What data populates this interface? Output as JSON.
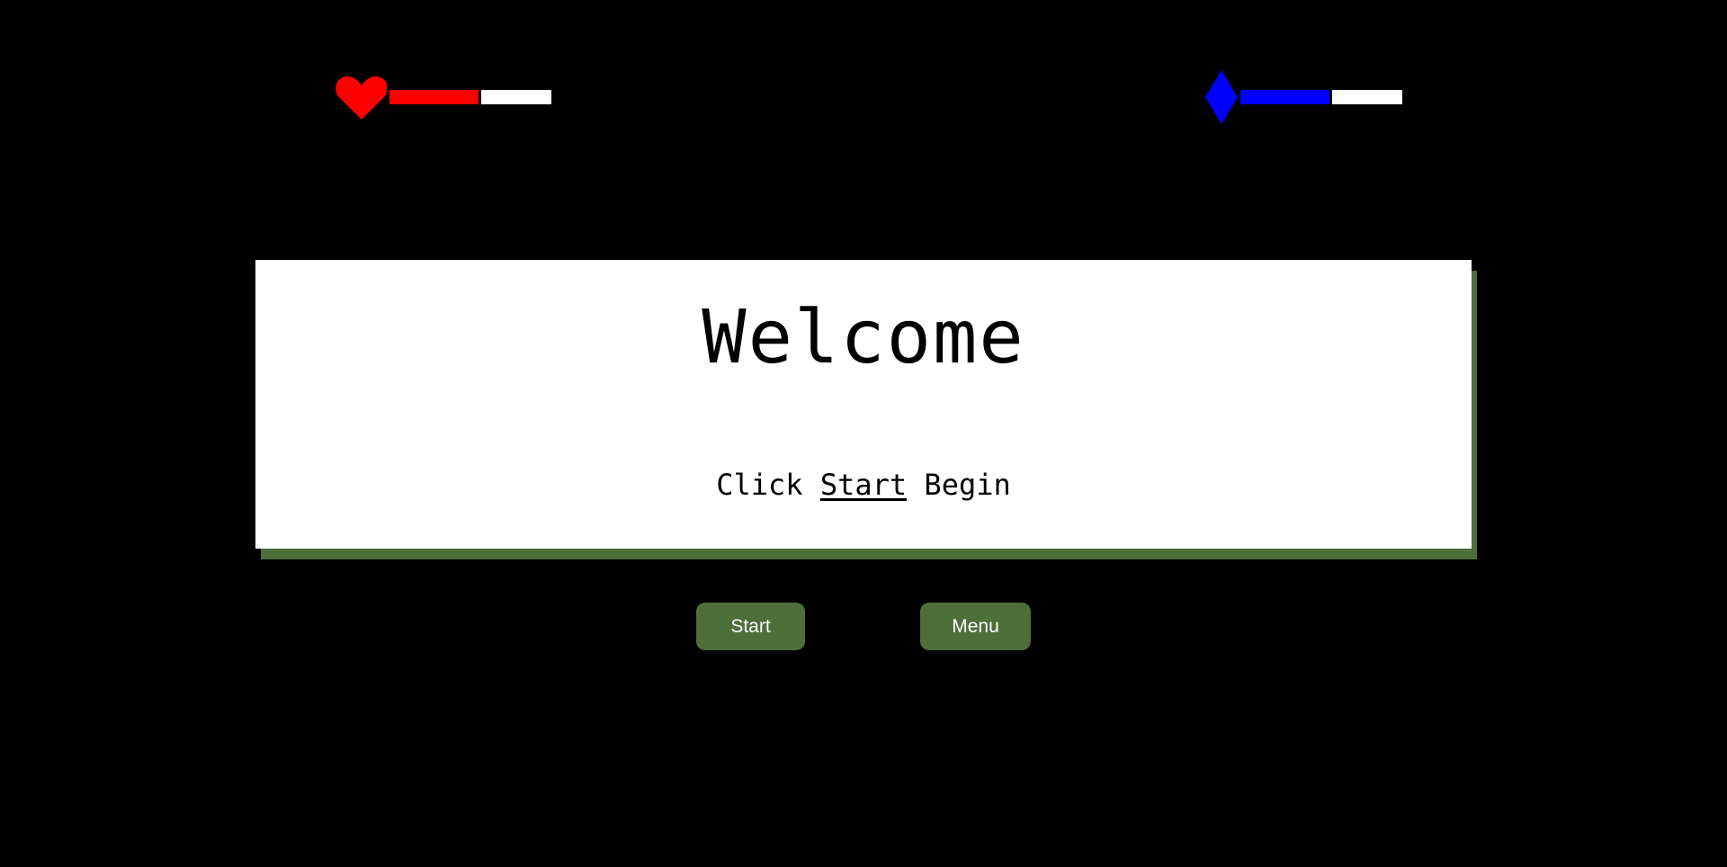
{
  "hud": {
    "health": {
      "icon": "heart-icon",
      "color": "#ff0000",
      "fill_fraction": 0.55
    },
    "mana": {
      "icon": "diamond-icon",
      "color": "#0000ff",
      "fill_fraction": 0.55
    }
  },
  "dialog": {
    "title": "Welcome",
    "hint_prefix": "Click",
    "hint_link": "Start",
    "hint_suffix": "Begin"
  },
  "buttons": {
    "start_label": "Start",
    "menu_label": "Menu"
  },
  "colors": {
    "background": "#000000",
    "accent": "#4e6e3a",
    "panel": "#ffffff"
  }
}
